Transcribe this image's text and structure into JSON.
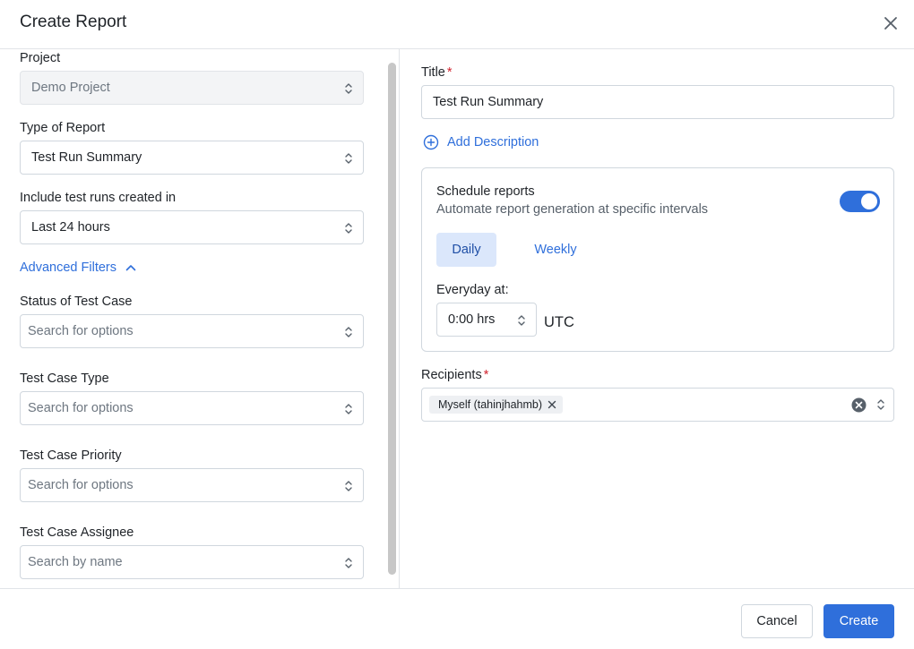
{
  "header": {
    "title": "Create Report",
    "close_icon": "close-icon"
  },
  "left": {
    "project": {
      "label": "Project",
      "value": "Demo Project"
    },
    "report_type": {
      "label": "Type of Report",
      "value": "Test Run Summary"
    },
    "time_range": {
      "label": "Include test runs created in",
      "value": "Last 24 hours"
    },
    "advanced_filters": {
      "label": "Advanced Filters",
      "icon": "chevron-up-icon"
    },
    "status": {
      "label": "Status of Test Case",
      "placeholder": "Search for options"
    },
    "case_type": {
      "label": "Test Case Type",
      "placeholder": "Search for options"
    },
    "priority": {
      "label": "Test Case Priority",
      "placeholder": "Search for options"
    },
    "assignee": {
      "label": "Test Case Assignee",
      "placeholder": "Search by name"
    }
  },
  "right": {
    "title": {
      "label": "Title",
      "required_mark": "*",
      "value": "Test Run Summary"
    },
    "add_description": {
      "label": "Add Description",
      "icon": "plus-circle-icon"
    },
    "schedule": {
      "title": "Schedule reports",
      "subtitle": "Automate report generation at specific intervals",
      "enabled": true,
      "tabs": [
        "Daily",
        "Weekly"
      ],
      "selected_tab": "Daily",
      "everyday_label": "Everyday at:",
      "time_value": "0:00 hrs",
      "timezone": "UTC"
    },
    "recipients": {
      "label": "Recipients",
      "required_mark": "*",
      "chips": [
        "Myself (tahinjhahmb)"
      ]
    }
  },
  "footer": {
    "cancel_label": "Cancel",
    "create_label": "Create"
  },
  "colors": {
    "accent": "#2f6fdb",
    "required": "#d1242f",
    "selected_tab_bg": "#dbe7fb"
  }
}
